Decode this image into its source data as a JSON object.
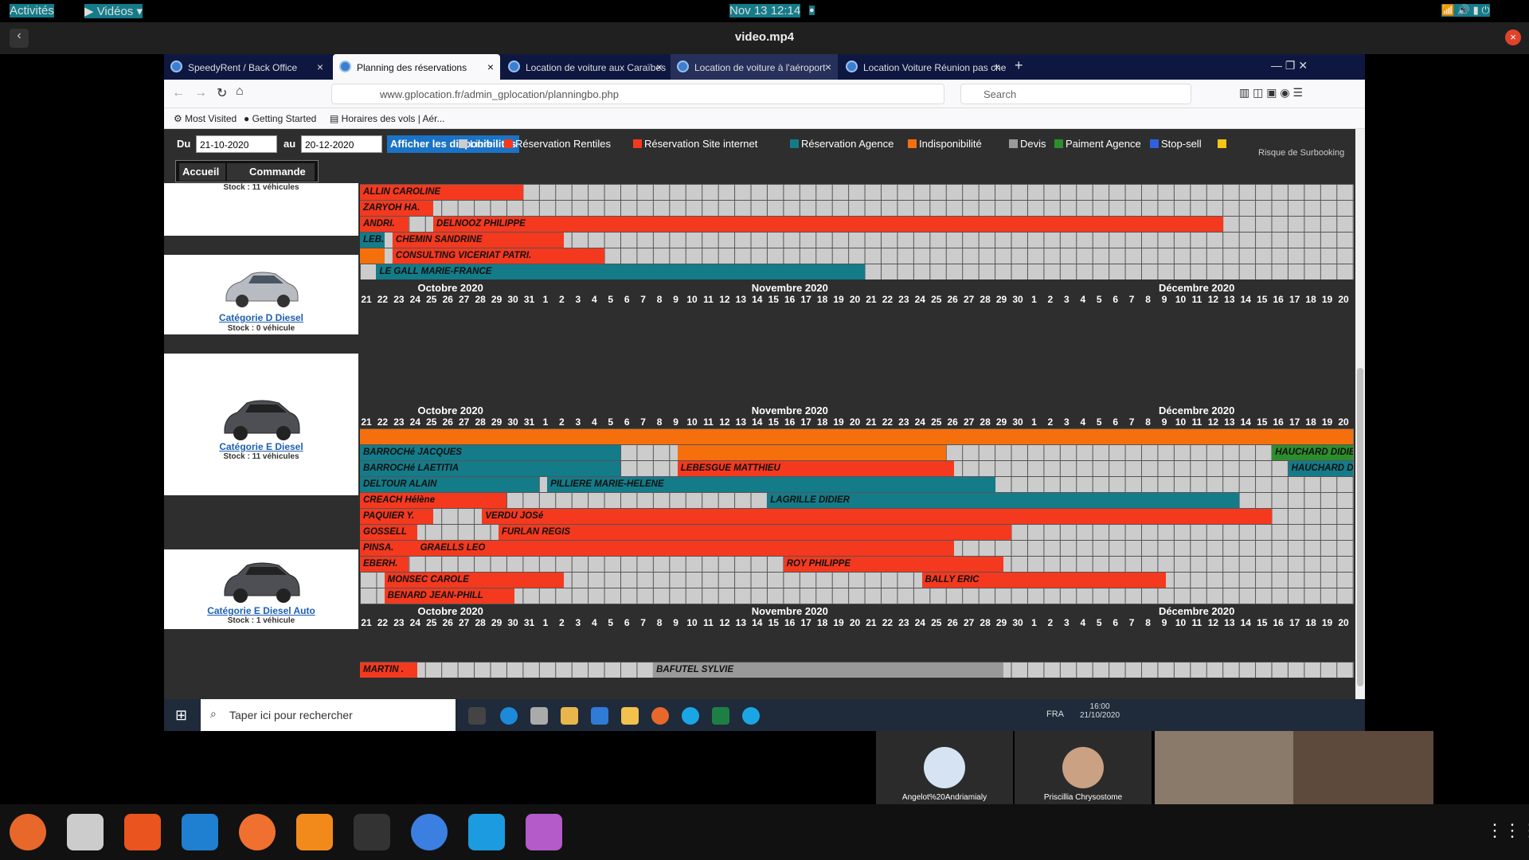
{
  "system": {
    "activities": "Activités",
    "app_menu": "Vidéos",
    "clock": "Nov 13  12:14"
  },
  "video": {
    "title": "video.mp4"
  },
  "browser": {
    "tabs": [
      "SpeedyRent / Back Office",
      "Planning des réservations",
      "Location de voiture aux Caraïbes",
      "Location de voiture à l'aéroport",
      "Location Voiture Réunion pas cher"
    ],
    "url": "www.gplocation.fr/admin_gplocation/planningbo.php",
    "search_placeholder": "Search",
    "bookmarks": [
      "Most Visited",
      "Getting Started",
      "Horaires des vols | Aér..."
    ]
  },
  "filters": {
    "du_label": "Du",
    "du_value": "21-10-2020",
    "au_label": "au",
    "au_value": "20-12-2020",
    "show_button": "Afficher les disponibilités",
    "legend": [
      {
        "label": "Libre",
        "color": "#cccccc"
      },
      {
        "label": "Réservation Rentiles",
        "color": "#f4391f"
      },
      {
        "label": "Réservation Site internet",
        "color": "#f4391f"
      },
      {
        "label": "Réservation Agence",
        "color": "#147b89"
      },
      {
        "label": "Indisponibilité",
        "color": "#f56f0c"
      },
      {
        "label": "Devis",
        "color": "#999999"
      },
      {
        "label": "Paiment Agence",
        "color": "#2d8d2d"
      },
      {
        "label": "Stop-sell",
        "color": "#3060e0"
      },
      {
        "label": "",
        "color": "#f5c518"
      }
    ],
    "risk": "Risque de Surbooking"
  },
  "nav": {
    "home": "Accueil",
    "order": "Commande"
  },
  "months": [
    "Octobre 2020",
    "Novembre 2020",
    "Décembre 2020"
  ],
  "days": [
    "21",
    "22",
    "23",
    "24",
    "25",
    "26",
    "27",
    "28",
    "29",
    "30",
    "31",
    "1",
    "2",
    "3",
    "4",
    "5",
    "6",
    "7",
    "8",
    "9",
    "10",
    "11",
    "12",
    "13",
    "14",
    "15",
    "16",
    "17",
    "18",
    "19",
    "20",
    "21",
    "22",
    "23",
    "24",
    "25",
    "26",
    "27",
    "28",
    "29",
    "30",
    "1",
    "2",
    "3",
    "4",
    "5",
    "6",
    "7",
    "8",
    "9",
    "10",
    "11",
    "12",
    "13",
    "14",
    "15",
    "16",
    "17",
    "18",
    "19",
    "20"
  ],
  "categories": [
    {
      "stock": "Stock : 11 véhicules"
    },
    {
      "name": "Catégorie D Diesel",
      "stock": "Stock : 0 véhicule"
    },
    {
      "name": "Catégorie E Diesel",
      "stock": "Stock : 11 véhicules"
    },
    {
      "name": "Catégorie E Diesel Auto",
      "stock": "Stock : 1 véhicule"
    }
  ],
  "reservations": {
    "block1": [
      {
        "row": 0,
        "start": 0,
        "end": 10,
        "type": "r",
        "label": "ALLIN CAROLINE"
      },
      {
        "row": 1,
        "start": 0,
        "end": 4.5,
        "type": "r",
        "label": "ZARYOH HA."
      },
      {
        "row": 2,
        "start": 0,
        "end": 3,
        "type": "r",
        "label": "ANDRI."
      },
      {
        "row": 2,
        "start": 4.5,
        "end": 53,
        "type": "r",
        "label": "DELNOOZ PHILIPPE"
      },
      {
        "row": 3,
        "start": 0,
        "end": 1.5,
        "type": "t",
        "label": "LEB."
      },
      {
        "row": 3,
        "start": 2,
        "end": 12.5,
        "type": "r",
        "label": "CHEMIN SANDRINE"
      },
      {
        "row": 4,
        "start": 0,
        "end": 1.5,
        "type": "o",
        "label": ""
      },
      {
        "row": 4,
        "start": 2,
        "end": 15,
        "type": "r",
        "label": "CONSULTING VICERIAT PATRI."
      },
      {
        "row": 5,
        "start": 1,
        "end": 31,
        "type": "t",
        "label": "LE GALL MARIE-FRANCE"
      }
    ],
    "block3": [
      {
        "row": 0,
        "start": 0,
        "end": 61,
        "type": "o",
        "label": ""
      },
      {
        "row": 1,
        "start": 0,
        "end": 16,
        "type": "t",
        "label": "BARROCHé JACQUES"
      },
      {
        "row": 1,
        "start": 19.5,
        "end": 36,
        "type": "o",
        "label": ""
      },
      {
        "row": 1,
        "start": 56,
        "end": 61,
        "type": "gr",
        "label": "HAUCHARD DIDIER"
      },
      {
        "row": 2,
        "start": 0,
        "end": 16,
        "type": "t",
        "label": "BARROCHé LAETITIA"
      },
      {
        "row": 2,
        "start": 19.5,
        "end": 36.5,
        "type": "r",
        "label": "LEBESGUE MATTHIEU"
      },
      {
        "row": 2,
        "start": 57,
        "end": 61,
        "type": "t",
        "label": "HAUCHARD DIDIER"
      },
      {
        "row": 3,
        "start": 0,
        "end": 11,
        "type": "t",
        "label": "DELTOUR ALAIN"
      },
      {
        "row": 3,
        "start": 11.5,
        "end": 39,
        "type": "t",
        "label": "PILLIERE MARIE-HELENE"
      },
      {
        "row": 4,
        "start": 0,
        "end": 9,
        "type": "r",
        "label": "CREACH Hélène"
      },
      {
        "row": 4,
        "start": 25,
        "end": 54,
        "type": "t",
        "label": "LAGRILLE DIDIER"
      },
      {
        "row": 5,
        "start": 0,
        "end": 4.5,
        "type": "r",
        "label": "PAQUIER Y."
      },
      {
        "row": 5,
        "start": 7.5,
        "end": 56,
        "type": "r",
        "label": "VERDU JOSé"
      },
      {
        "row": 6,
        "start": 0,
        "end": 3.5,
        "type": "r",
        "label": "GOSSELL"
      },
      {
        "row": 6,
        "start": 8.5,
        "end": 40,
        "type": "r",
        "label": "FURLAN REGIS"
      },
      {
        "row": 7,
        "start": 0,
        "end": 3.5,
        "type": "r",
        "label": "PINSA."
      },
      {
        "row": 7,
        "start": 3.5,
        "end": 36.5,
        "type": "r",
        "label": "GRAELLS LEO"
      },
      {
        "row": 8,
        "start": 0,
        "end": 3,
        "type": "r",
        "label": "EBERH."
      },
      {
        "row": 8,
        "start": 26,
        "end": 39.5,
        "type": "r",
        "label": "ROY PHILIPPE"
      },
      {
        "row": 9,
        "start": 1.5,
        "end": 12.5,
        "type": "r",
        "label": "MONSEC CAROLE"
      },
      {
        "row": 9,
        "start": 34.5,
        "end": 49.5,
        "type": "r",
        "label": "BALLY ERIC"
      },
      {
        "row": 10,
        "start": 1.5,
        "end": 9.5,
        "type": "r",
        "label": "BENARD JEAN-PHILL"
      }
    ],
    "block4": [
      {
        "row": 0,
        "start": 0,
        "end": 3.5,
        "type": "r",
        "label": "MARTIN ."
      },
      {
        "row": 0,
        "start": 18,
        "end": 39.5,
        "type": "g",
        "label": "BAFUTEL SYLVIE"
      }
    ]
  },
  "taskbar": {
    "search": "Taper ici pour rechercher",
    "lang": "FRA",
    "time": "16:00",
    "date": "21/10/2020"
  },
  "call": {
    "p1": "Angelot%20Andriamialy",
    "p2": "Priscillia Chrysostome"
  }
}
